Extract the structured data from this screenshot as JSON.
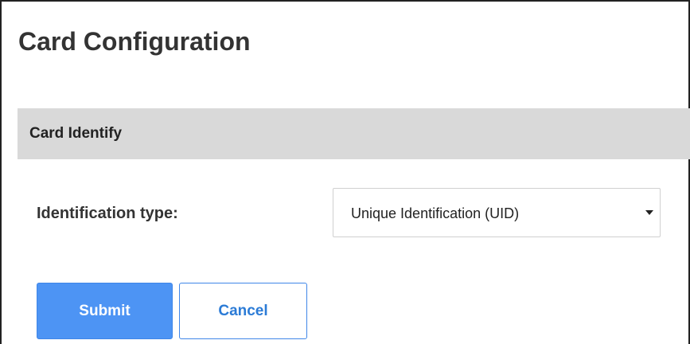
{
  "page": {
    "title": "Card Configuration"
  },
  "section": {
    "title": "Card Identify"
  },
  "form": {
    "identification_type": {
      "label": "Identification type:",
      "selected": "Unique Identification (UID)"
    }
  },
  "buttons": {
    "submit_label": "Submit",
    "cancel_label": "Cancel"
  },
  "icons": {
    "select_caret": "chevron-down-icon"
  },
  "colors": {
    "submit_bg": "#4d94f4",
    "cancel_text": "#2b7bd6",
    "section_bg": "#d9d9d9"
  }
}
